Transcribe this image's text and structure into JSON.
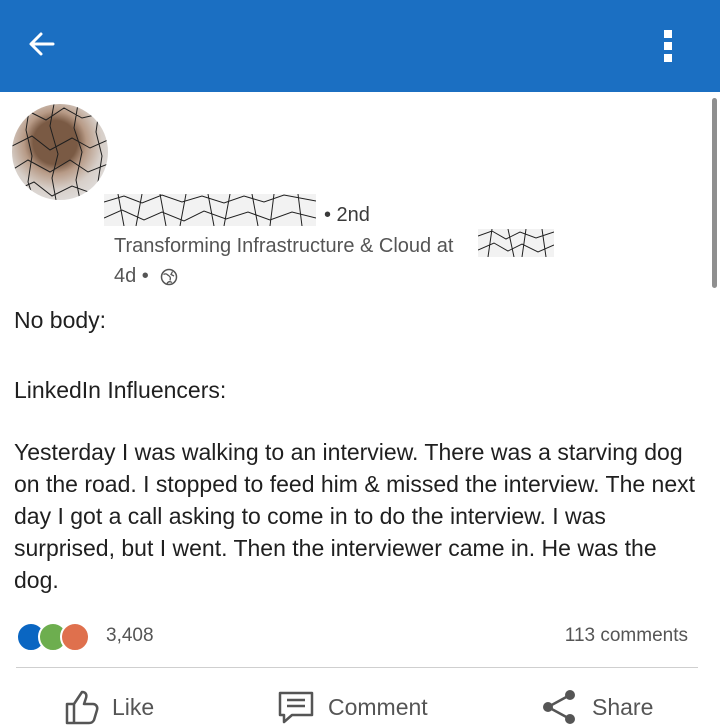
{
  "topbar": {
    "back_icon": "arrow-left-icon",
    "more_icon": "vertical-ellipsis-icon",
    "color": "#1b6fc2"
  },
  "author": {
    "degree": "• 2nd",
    "headline": "Transforming Infrastructure & Cloud at",
    "time": "4d •",
    "visibility_icon": "globe-icon"
  },
  "post": {
    "line1": "No body:",
    "line2": "LinkedIn Influencers:",
    "story": "Yesterday I was walking to an interview. There was a starving dog on the road. I stopped to feed him & missed the interview. The next day I got a call asking to come in to do the interview. I was surprised, but I went. Then the interviewer came in. He was the dog."
  },
  "social": {
    "reactions_count": "3,408",
    "comments_count": "113 comments",
    "reaction_icons": [
      "like-icon",
      "celebrate-icon",
      "love-icon"
    ]
  },
  "actions": {
    "like": "Like",
    "comment": "Comment",
    "share": "Share"
  }
}
